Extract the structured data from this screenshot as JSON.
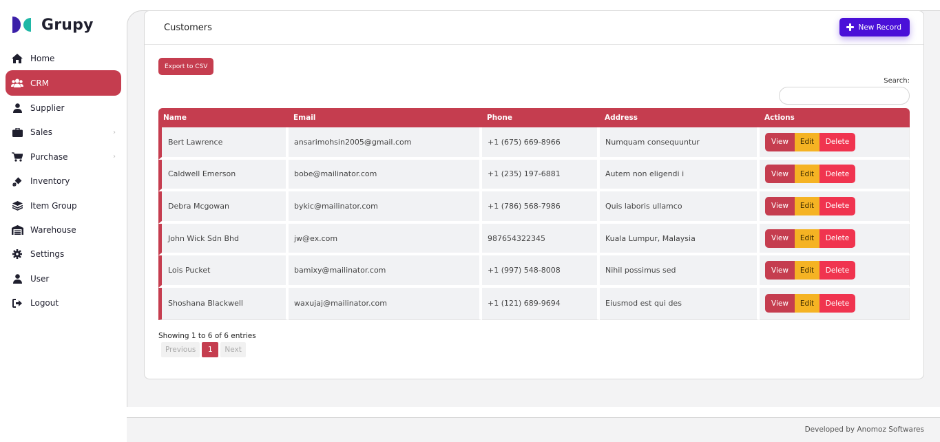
{
  "brand": {
    "name": "Grupy"
  },
  "sidebar": {
    "items": [
      {
        "label": "Home",
        "icon": "home-icon"
      },
      {
        "label": "CRM",
        "icon": "users-icon",
        "active": true
      },
      {
        "label": "Supplier",
        "icon": "user-icon"
      },
      {
        "label": "Sales",
        "icon": "briefcase-icon",
        "chevron": "›"
      },
      {
        "label": "Purchase",
        "icon": "cart-icon",
        "chevron": "›"
      },
      {
        "label": "Inventory",
        "icon": "dolly-icon"
      },
      {
        "label": "Item Group",
        "icon": "layers-icon"
      },
      {
        "label": "Warehouse",
        "icon": "warehouse-icon"
      },
      {
        "label": "Settings",
        "icon": "gear-icon"
      },
      {
        "label": "User",
        "icon": "user-icon"
      },
      {
        "label": "Logout",
        "icon": "logout-icon"
      }
    ]
  },
  "card": {
    "title": "Customers",
    "new_record_label": "New Record",
    "export_label": "Export to CSV",
    "search_label": "Search:"
  },
  "table": {
    "columns": [
      "Name",
      "Email",
      "Phone",
      "Address",
      "Actions"
    ],
    "rows": [
      {
        "name": "Bert Lawrence",
        "email": "ansarimohsin2005@gmail.com",
        "phone": "+1 (675) 669-8966",
        "address": "Numquam consequuntur"
      },
      {
        "name": "Caldwell Emerson",
        "email": "bobe@mailinator.com",
        "phone": "+1 (235) 197-6881",
        "address": "Autem non eligendi i"
      },
      {
        "name": "Debra Mcgowan",
        "email": "bykic@mailinator.com",
        "phone": "+1 (786) 568-7986",
        "address": "Quis laboris ullamco"
      },
      {
        "name": "John Wick Sdn Bhd",
        "email": "jw@ex.com",
        "phone": "987654322345",
        "address": "Kuala Lumpur, Malaysia"
      },
      {
        "name": "Lois Pucket",
        "email": "bamixy@mailinator.com",
        "phone": "+1 (997) 548-8008",
        "address": "Nihil possimus sed"
      },
      {
        "name": "Shoshana Blackwell",
        "email": "waxujaj@mailinator.com",
        "phone": "+1 (121) 689-9694",
        "address": "Eiusmod est qui des"
      }
    ],
    "actions": {
      "view": "View",
      "edit": "Edit",
      "delete": "Delete"
    }
  },
  "pagination": {
    "showing": "Showing 1 to 6 of 6 entries",
    "previous": "Previous",
    "current": "1",
    "next": "Next"
  },
  "footer": {
    "text": "Developed by Anomoz Softwares"
  },
  "colors": {
    "accent": "#c53d4f",
    "primary": "#4a10d8",
    "edit": "#f5b323",
    "delete": "#f0344f"
  }
}
